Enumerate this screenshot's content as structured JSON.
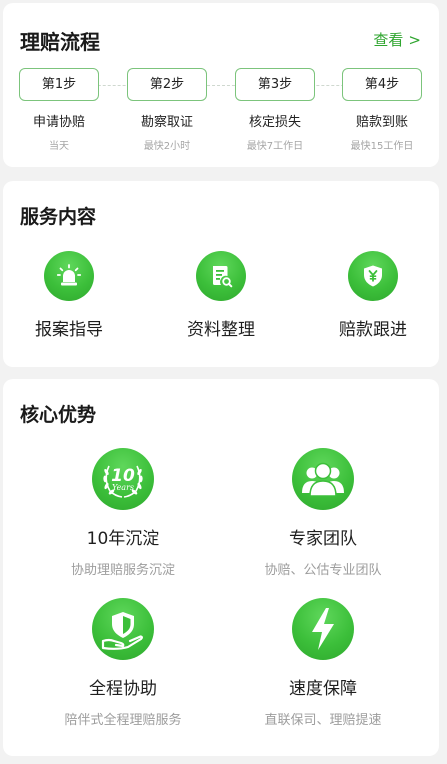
{
  "process": {
    "title": "理赔流程",
    "view_label": "查看",
    "view_arrow": ">",
    "steps": [
      {
        "label": "第1步",
        "name": "申请协赔",
        "time": "当天"
      },
      {
        "label": "第2步",
        "name": "勘察取证",
        "time": "最快2小时"
      },
      {
        "label": "第3步",
        "name": "核定损失",
        "time": "最快7工作日"
      },
      {
        "label": "第4步",
        "name": "赔款到账",
        "time": "最快15工作日"
      }
    ]
  },
  "services": {
    "title": "服务内容",
    "items": [
      {
        "label": "报案指导",
        "icon": "alarm-light-icon"
      },
      {
        "label": "资料整理",
        "icon": "document-search-icon"
      },
      {
        "label": "赔款跟进",
        "icon": "shield-yen-icon"
      }
    ]
  },
  "advantages": {
    "title": "核心优势",
    "badge_number": "10",
    "badge_script": "Years",
    "items": [
      {
        "title": "10年沉淀",
        "subtitle": "协助理赔服务沉淀",
        "icon": "ten-years-laurel-icon"
      },
      {
        "title": "专家团队",
        "subtitle": "协赔、公估专业团队",
        "icon": "team-icon"
      },
      {
        "title": "全程协助",
        "subtitle": "陪伴式全程理赔服务",
        "icon": "shield-hand-icon"
      },
      {
        "title": "速度保障",
        "subtitle": "直联保司、理赔提速",
        "icon": "lightning-icon"
      }
    ]
  },
  "colors": {
    "accent": "#3cbf3a",
    "accent_dark": "#2ea82d",
    "link": "#2fa52f",
    "step_border": "#7cc47c",
    "background": "#f2f2f2",
    "card": "#ffffff",
    "muted_text": "#9d9d9d"
  }
}
